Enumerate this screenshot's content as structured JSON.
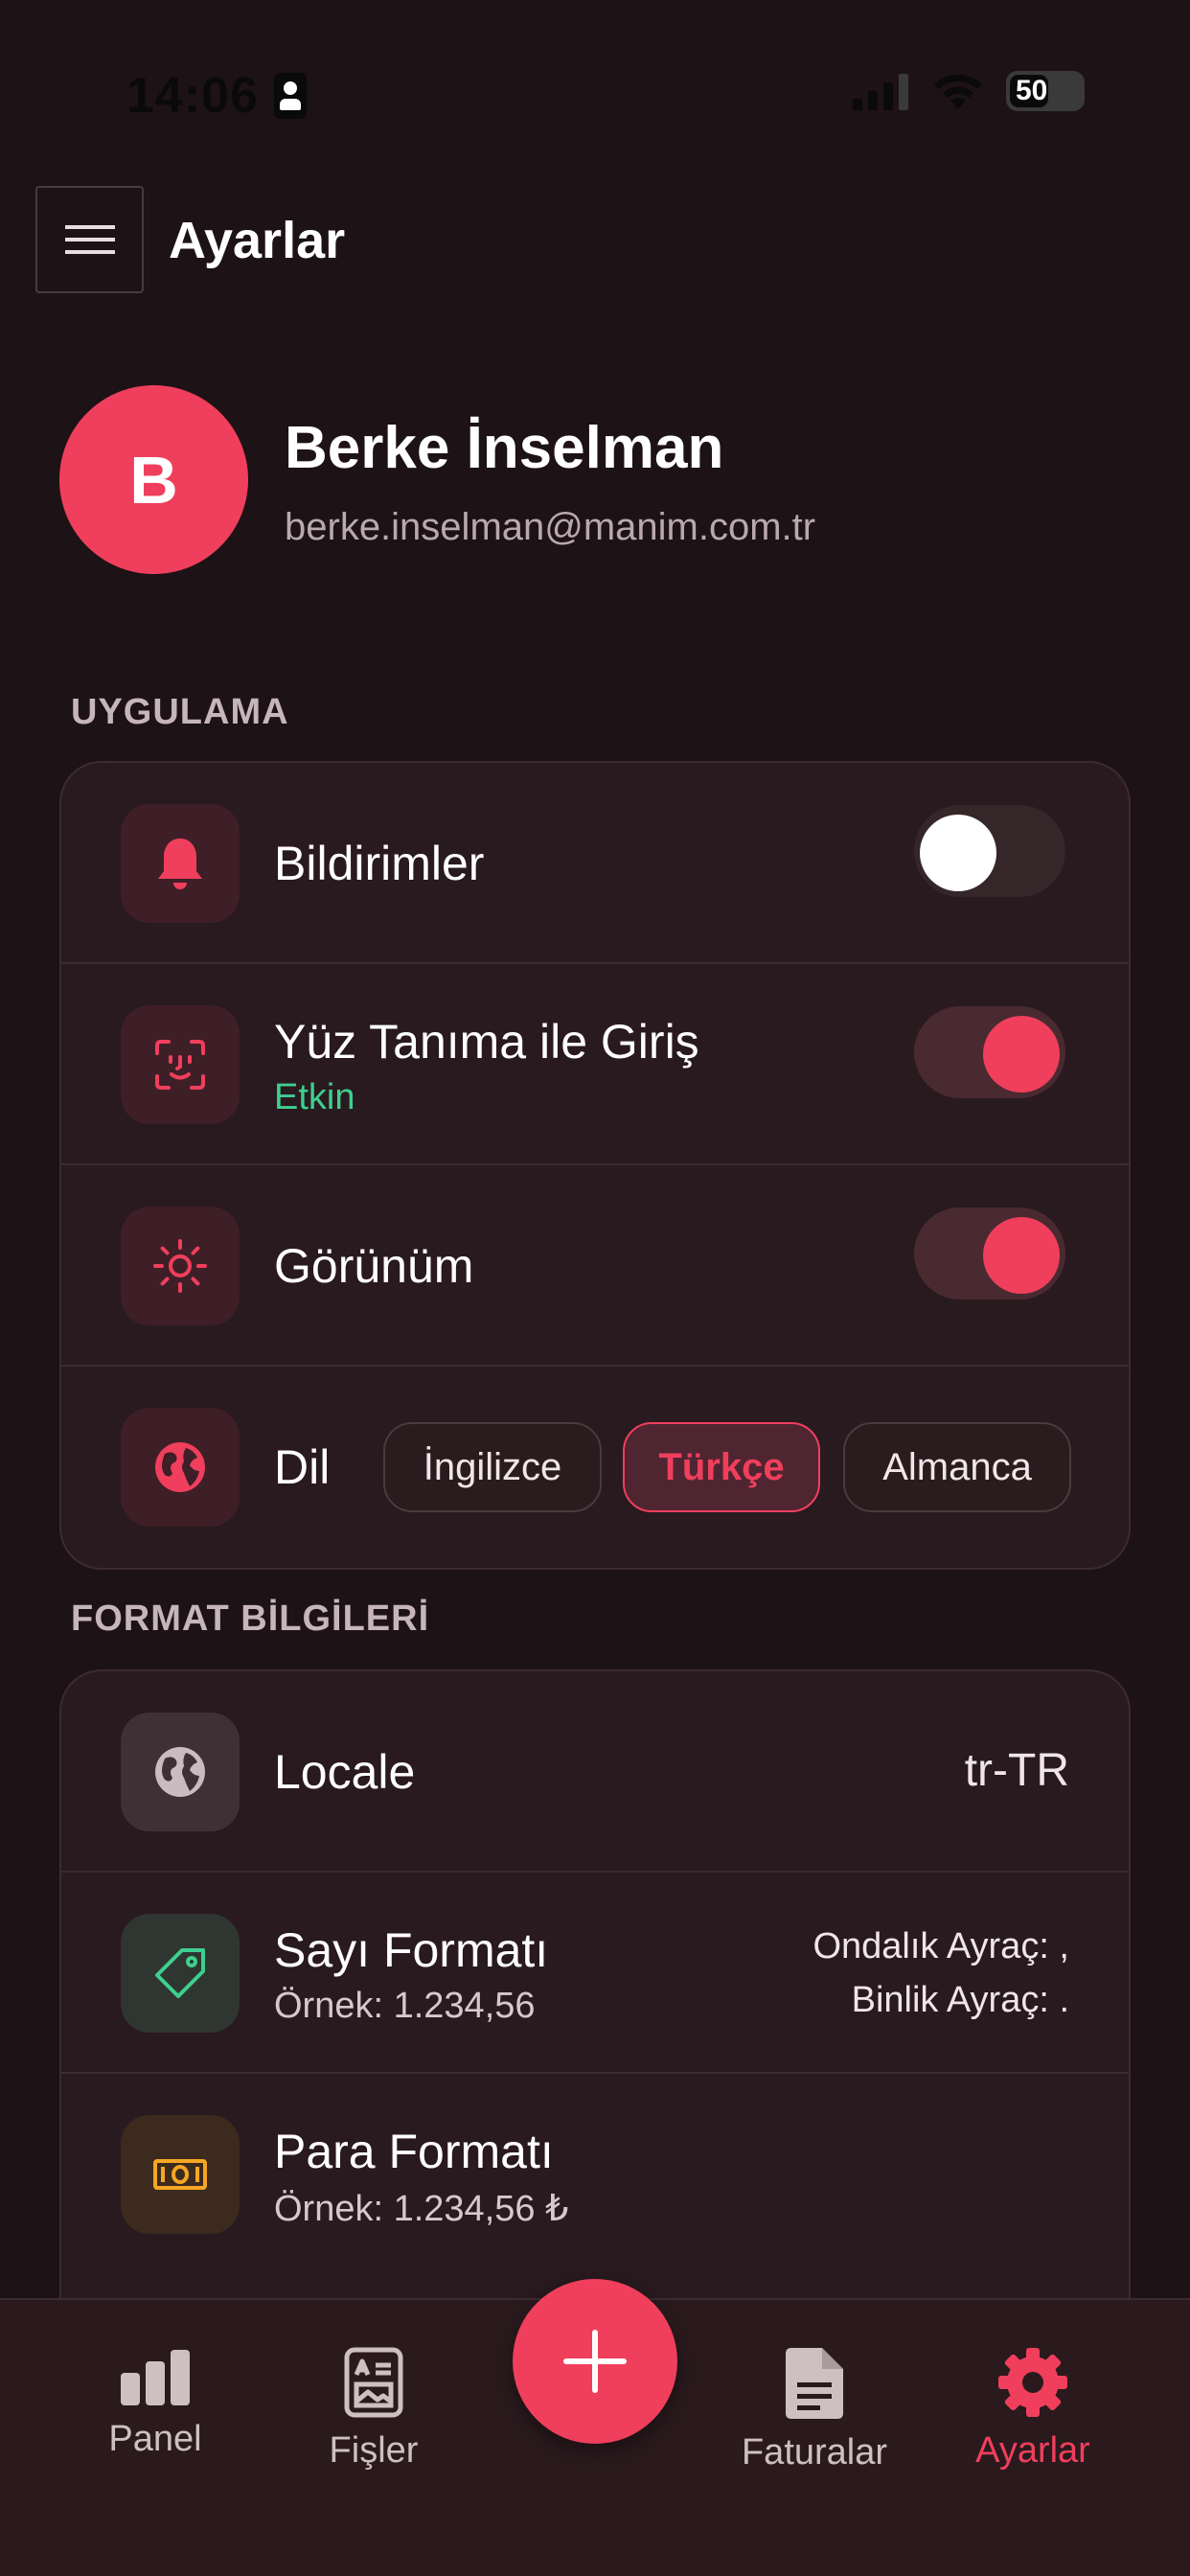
{
  "status": {
    "time": "14:06",
    "battery": "50"
  },
  "header": {
    "title": "Ayarlar"
  },
  "profile": {
    "initial": "B",
    "name": "Berke İnselman",
    "email": "berke.inselman@manim.com.tr"
  },
  "sections": {
    "app": {
      "label": "UYGULAMA",
      "notifications": {
        "title": "Bildirimler",
        "enabled": false
      },
      "face_id": {
        "title": "Yüz Tanıma ile Giriş",
        "status": "Etkin",
        "enabled": true
      },
      "appearance": {
        "title": "Görünüm",
        "enabled": true
      },
      "language": {
        "title": "Dil",
        "options": [
          "İngilizce",
          "Türkçe",
          "Almanca"
        ],
        "selected": "Türkçe"
      }
    },
    "format": {
      "label": "FORMAT BİLGİLERİ",
      "locale": {
        "title": "Locale",
        "value": "tr-TR"
      },
      "number": {
        "title": "Sayı Formatı",
        "example": "Örnek: 1.234,56",
        "decimal": "Ondalık Ayraç: ,",
        "thousands": "Binlik Ayraç: ."
      },
      "currency": {
        "title": "Para Formatı",
        "example": "Örnek: 1.234,56 ₺"
      }
    }
  },
  "nav": {
    "items": [
      "Panel",
      "Fişler",
      "Faturalar",
      "Ayarlar"
    ],
    "active": "Ayarlar"
  },
  "colors": {
    "accent": "#ef3f5d",
    "background": "#1d1215",
    "card": "#281a1e",
    "success": "#3ecf8e"
  }
}
